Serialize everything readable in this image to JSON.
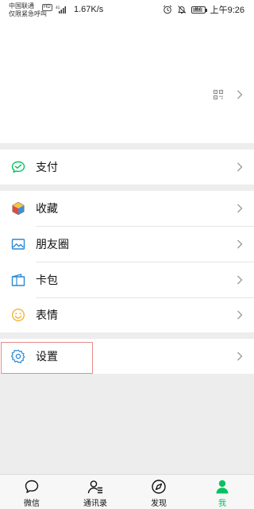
{
  "status_bar": {
    "carrier_line1": "中国联通",
    "carrier_line2": "仅限紧急呼叫",
    "network_badge": "HD",
    "network_type": "4G",
    "speed": "1.67K/s",
    "battery": "87",
    "time": "上午9:26",
    "icons": [
      "alarm-icon",
      "mute-icon"
    ]
  },
  "menu": {
    "pay": "支付",
    "favorites": "收藏",
    "moments": "朋友圈",
    "cards": "卡包",
    "stickers": "表情",
    "settings": "设置"
  },
  "tabbar": {
    "tabs": [
      {
        "label": "微信",
        "icon": "chat-icon"
      },
      {
        "label": "通讯录",
        "icon": "contacts-icon"
      },
      {
        "label": "发现",
        "icon": "discover-compass-icon"
      },
      {
        "label": "我",
        "icon": "me-person-icon"
      }
    ],
    "active_index": 3
  },
  "colors": {
    "accent_green": "#07c160",
    "background": "#ededed",
    "highlight_box": "#e88b8b"
  }
}
